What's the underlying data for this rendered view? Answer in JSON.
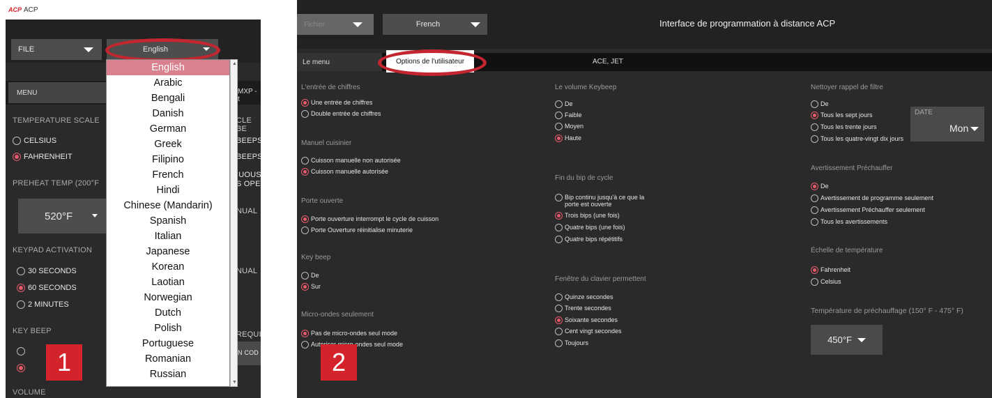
{
  "panel1": {
    "app_title": "ACP",
    "file_label": "FILE",
    "language_selected": "English",
    "menu_tab": "MENU",
    "right_tab": "MXP - t",
    "temp_scale": {
      "label": "TEMPERATURE SCALE",
      "options": [
        "CELSIUS",
        "FAHRENHEIT"
      ],
      "selected": 1
    },
    "preheat_label": "PREHEAT TEMP (200°F",
    "preheat_value": "520°F",
    "keypad": {
      "label": "KEYPAD ACTIVATION",
      "options": [
        "30 SECONDS",
        "60 SECONDS",
        "2 MINUTES"
      ],
      "selected": 1
    },
    "key_beep_label": "KEY BEEP",
    "volume_label": "VOLUME",
    "right_fragments": [
      "CLE BE",
      "BEEPS",
      "BEEPS",
      "IUOUS",
      "S OPE",
      "NUAL",
      "NUAL",
      "REQUI",
      "N COD"
    ],
    "languages": [
      "English",
      "Arabic",
      "Bengali",
      "Danish",
      "German",
      "Greek",
      "Filipino",
      "French",
      "Hindi",
      "Chinese (Mandarin)",
      "Spanish",
      "Italian",
      "Japanese",
      "Korean",
      "Laotian",
      "Norwegian",
      "Dutch",
      "Polish",
      "Portuguese",
      "Romanian",
      "Russian"
    ],
    "badge": "1"
  },
  "panel2": {
    "file_label": "Fichier",
    "language": "French",
    "title": "Interface de programmation à distance ACP",
    "tabs": [
      "Le menu",
      "Options de l'utilisateur",
      "ACE, JET"
    ],
    "badge": "2",
    "col1": {
      "digit_entry": {
        "label": "L'entrée de chiffres",
        "options": [
          "Une entrée de chiffres",
          "Double entrée de chiffres"
        ],
        "selected": 0
      },
      "manual": {
        "label": "Manuel cuisinier",
        "options": [
          "Cuisson manuelle non autorisée",
          "Cuisson manuelle autorisée"
        ],
        "selected": 1
      },
      "door": {
        "label": "Porte ouverte",
        "options": [
          "Porte ouverture interrompt le cycle de cuisson",
          "Porte Ouverture réinitialise minuterie"
        ],
        "selected": 0
      },
      "key_beep": {
        "label": "Key beep",
        "options": [
          "De",
          "Sur"
        ],
        "selected": 1
      },
      "micro": {
        "label": "Micro-ondes seulement",
        "options": [
          "Pas de micro-ondes seul mode",
          "Autoriser micro-ondes seul mode"
        ],
        "selected": 0
      }
    },
    "col2": {
      "volume": {
        "label": "Le volume Keybeep",
        "options": [
          "De",
          "Faible",
          "Moyen",
          "Haute"
        ],
        "selected": 3
      },
      "cycle_end": {
        "label": "Fin du bip de cycle",
        "options": [
          "Bip continu jusqu'à ce que la porte est ouverte",
          "Trois bips (une fois)",
          "Quatre bips (une fois)",
          "Quatre bips répétitifs"
        ],
        "selected": 1
      },
      "keypad": {
        "label": "Fenêtre du clavier permettent",
        "options": [
          "Quinze secondes",
          "Trente secondes",
          "Soixante secondes",
          "Cent vingt secondes",
          "Toujours"
        ],
        "selected": 2
      }
    },
    "col3": {
      "filter": {
        "label": "Nettoyer rappel de filtre",
        "options": [
          "De",
          "Tous les sept jours",
          "Tous les trente jours",
          "Tous les quatre-vingt dix jours"
        ],
        "selected": 1
      },
      "date_label": "DATE",
      "date_value": "Mon",
      "preheat_warn": {
        "label": "Avertissement Préchauffer",
        "options": [
          "De",
          "Avertissement de programme seulement",
          "Avertissement Préchauffer seulement",
          "Tous les avertissements"
        ],
        "selected": 0
      },
      "temp_scale": {
        "label": "Échelle de température",
        "options": [
          "Fahrenheit",
          "Celsius"
        ],
        "selected": 0
      },
      "preheat_temp_label": "Température de préchauffage (150° F - 475° F)",
      "preheat_temp_value": "450°F"
    }
  },
  "colors": {
    "accent": "#c3262e",
    "radio_on": "#e85a6a",
    "bg": "#2a2a2a"
  }
}
